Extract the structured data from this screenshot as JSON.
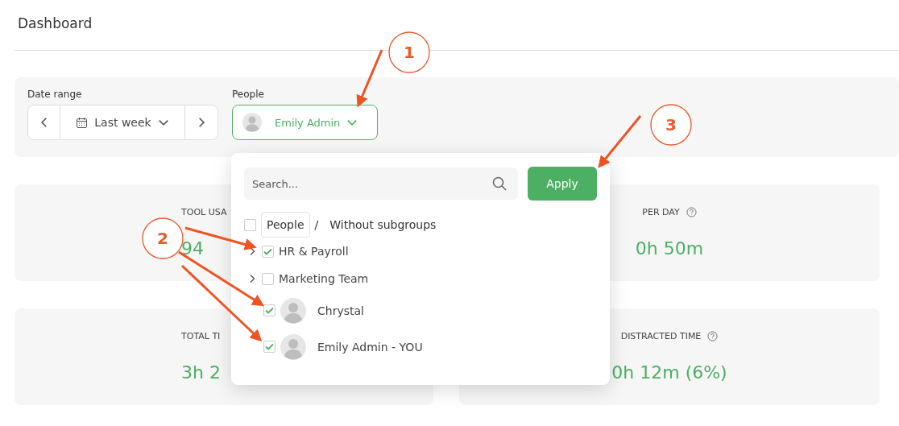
{
  "header": {
    "title": "Dashboard"
  },
  "filters": {
    "date_range": {
      "label": "Date range",
      "value": "Last week"
    },
    "people": {
      "label": "People",
      "value": "Emily Admin",
      "open": true
    }
  },
  "cards": [
    {
      "label": "TOOL USA",
      "value": "94",
      "help": false
    },
    {
      "label": "PER DAY",
      "value": "0h 50m",
      "help": true
    },
    {
      "label": "TOTAL TI",
      "value": "3h 2",
      "help": false
    },
    {
      "label": "DISTRACTED TIME",
      "value": "0h 12m (6%)",
      "help": true
    }
  ],
  "dropdown": {
    "search": {
      "placeholder": "Search..."
    },
    "apply": "Apply",
    "scope": {
      "checked": false,
      "group": "People",
      "separator": "/",
      "mode": "Without subgroups"
    },
    "items": [
      {
        "kind": "group",
        "name": "HR & Payroll",
        "checked": true
      },
      {
        "kind": "group",
        "name": "Marketing Team",
        "checked": false
      },
      {
        "kind": "person",
        "name": "Chrystal",
        "checked": true
      },
      {
        "kind": "person",
        "name": "Emily Admin",
        "suffix": "- YOU",
        "checked": true
      }
    ]
  },
  "callouts": [
    {
      "label": "1"
    },
    {
      "label": "2"
    },
    {
      "label": "3"
    }
  ]
}
